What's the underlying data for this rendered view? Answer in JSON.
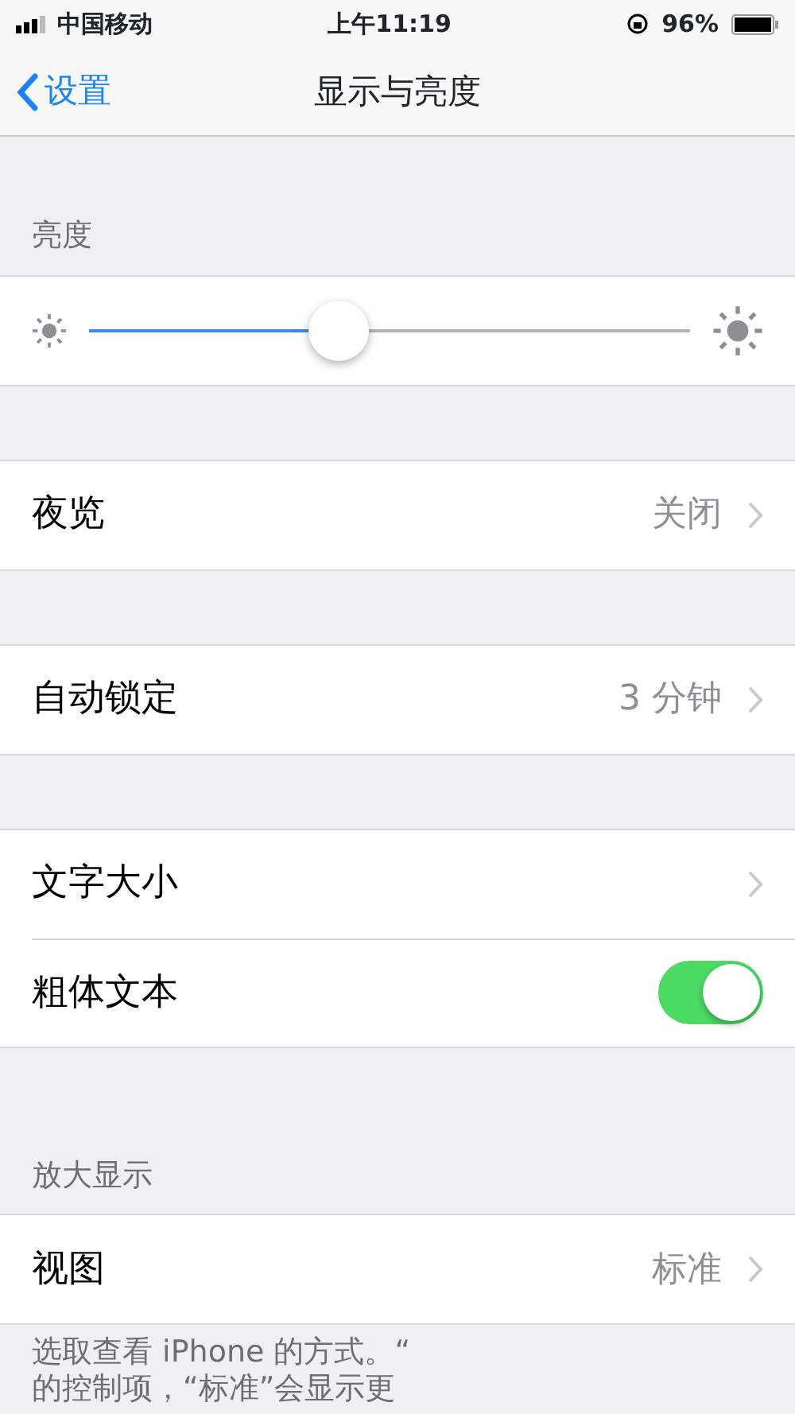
{
  "status_bar": {
    "carrier": "中国移动",
    "time": "上午11:19",
    "battery": "96%"
  },
  "nav": {
    "back": "设置",
    "title": "显示与亮度"
  },
  "sections": [
    {
      "header": "亮度",
      "rows": [
        {
          "kind": "slider",
          "level": 0.415
        }
      ]
    },
    {
      "rows": [
        {
          "kind": "disclosure",
          "label": "夜览",
          "value": "关闭"
        }
      ]
    },
    {
      "rows": [
        {
          "kind": "disclosure",
          "label": "自动锁定",
          "value": "3 分钟"
        }
      ]
    },
    {
      "rows": [
        {
          "kind": "disclosure",
          "label": "文字大小"
        },
        {
          "kind": "toggle",
          "label": "粗体文本",
          "on": true
        }
      ]
    },
    {
      "header": "放大显示",
      "rows": [
        {
          "kind": "disclosure",
          "label": "视图",
          "value": "标准"
        }
      ],
      "footer_lines": [
        "选取查看 iPhone 的方式。“",
        "的控制项，“标准”会显示更"
      ]
    }
  ]
}
